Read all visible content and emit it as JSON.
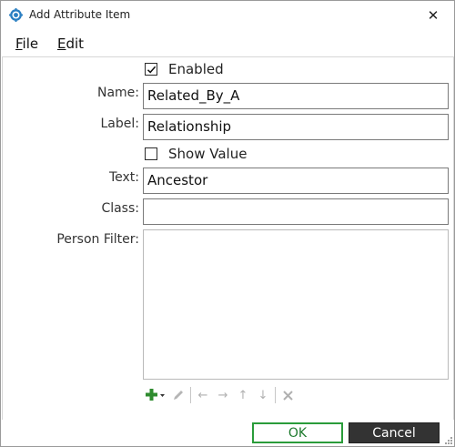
{
  "window": {
    "title": "Add Attribute Item",
    "close_symbol": "✕"
  },
  "menu": [
    {
      "label": "File",
      "accel": "F",
      "rest": "ile"
    },
    {
      "label": "Edit",
      "accel": "E",
      "rest": "dit"
    }
  ],
  "form": {
    "enabled": {
      "label": "Enabled",
      "checked": true
    },
    "name": {
      "label": "Name:",
      "value": "Related_By_A"
    },
    "label_field": {
      "label": "Label:",
      "value": "Relationship"
    },
    "show_value": {
      "label": "Show Value",
      "checked": false
    },
    "text": {
      "label": "Text:",
      "value": "Ancestor"
    },
    "class_field": {
      "label": "Class:",
      "value": ""
    },
    "person_filter": {
      "label": "Person Filter:",
      "items": []
    }
  },
  "toolbar": {
    "icons": [
      "add-icon",
      "edit-icon",
      "arrow-left-icon",
      "arrow-right-icon",
      "arrow-up-icon",
      "arrow-down-icon",
      "delete-icon"
    ]
  },
  "buttons": {
    "ok": "OK",
    "cancel": "Cancel"
  },
  "colors": {
    "accent_green": "#2a9c3a",
    "cancel_bg": "#333333",
    "add_green": "#2e8b2e"
  }
}
